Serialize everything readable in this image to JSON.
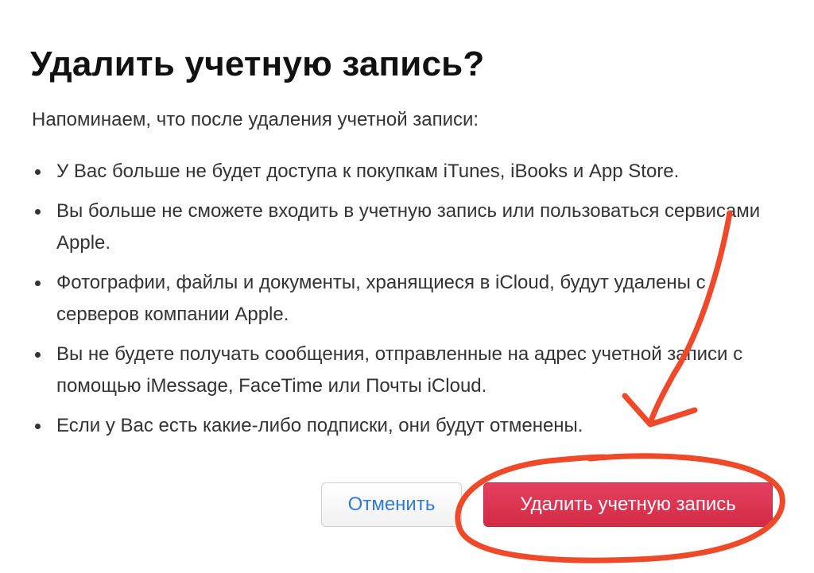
{
  "dialog": {
    "title": "Удалить учетную запись?",
    "intro": "Напоминаем, что после удаления учетной записи:",
    "bullets": [
      "У Вас больше не будет доступа к покупкам iTunes, iBooks и App Store.",
      "Вы больше не сможете входить в учетную запись или пользоваться сервисами Apple.",
      "Фотографии, файлы и документы, хранящиеся в iCloud, будут удалены с серверов компании Apple.",
      "Вы не будете получать сообщения, отправленные на адрес учетной записи с помощью iMessage, FaceTime или Почты iCloud.",
      "Если у Вас есть какие-либо подписки, они будут отменены."
    ],
    "cancel_label": "Отменить",
    "delete_label": "Удалить учетную запись"
  },
  "colors": {
    "delete_button": "#d93350",
    "cancel_text": "#2f7bd6",
    "annotation": "#ee4a2a"
  }
}
